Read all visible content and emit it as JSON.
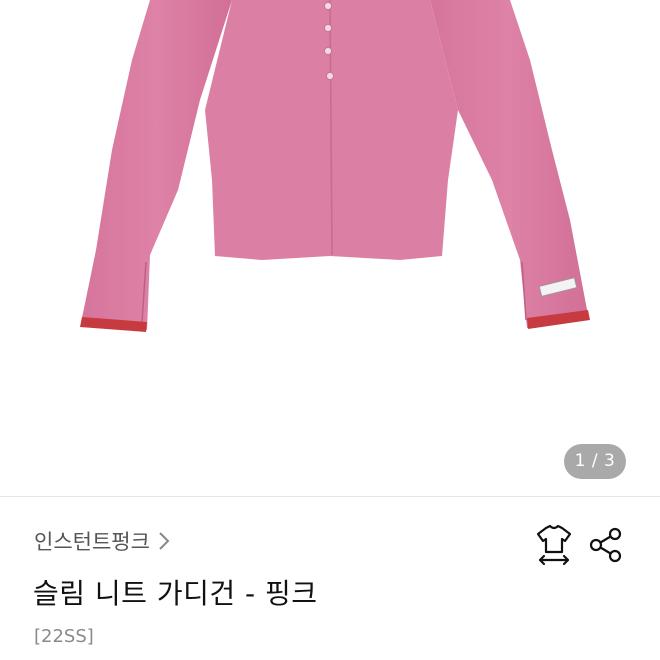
{
  "gallery": {
    "image_alt": "pink slim knit cardigan",
    "indicator": "1 / 3"
  },
  "brand": {
    "name": "인스턴트펑크"
  },
  "product": {
    "title": "슬림 니트 가디건 - 핑크",
    "season": "[22SS]"
  },
  "actions": {
    "size_icon": "shirt-size-icon",
    "share_icon": "share-icon"
  },
  "colors": {
    "garment": "#d9789f",
    "cuff": "#c73a3f",
    "indicator_bg": "#a9a9a9"
  }
}
